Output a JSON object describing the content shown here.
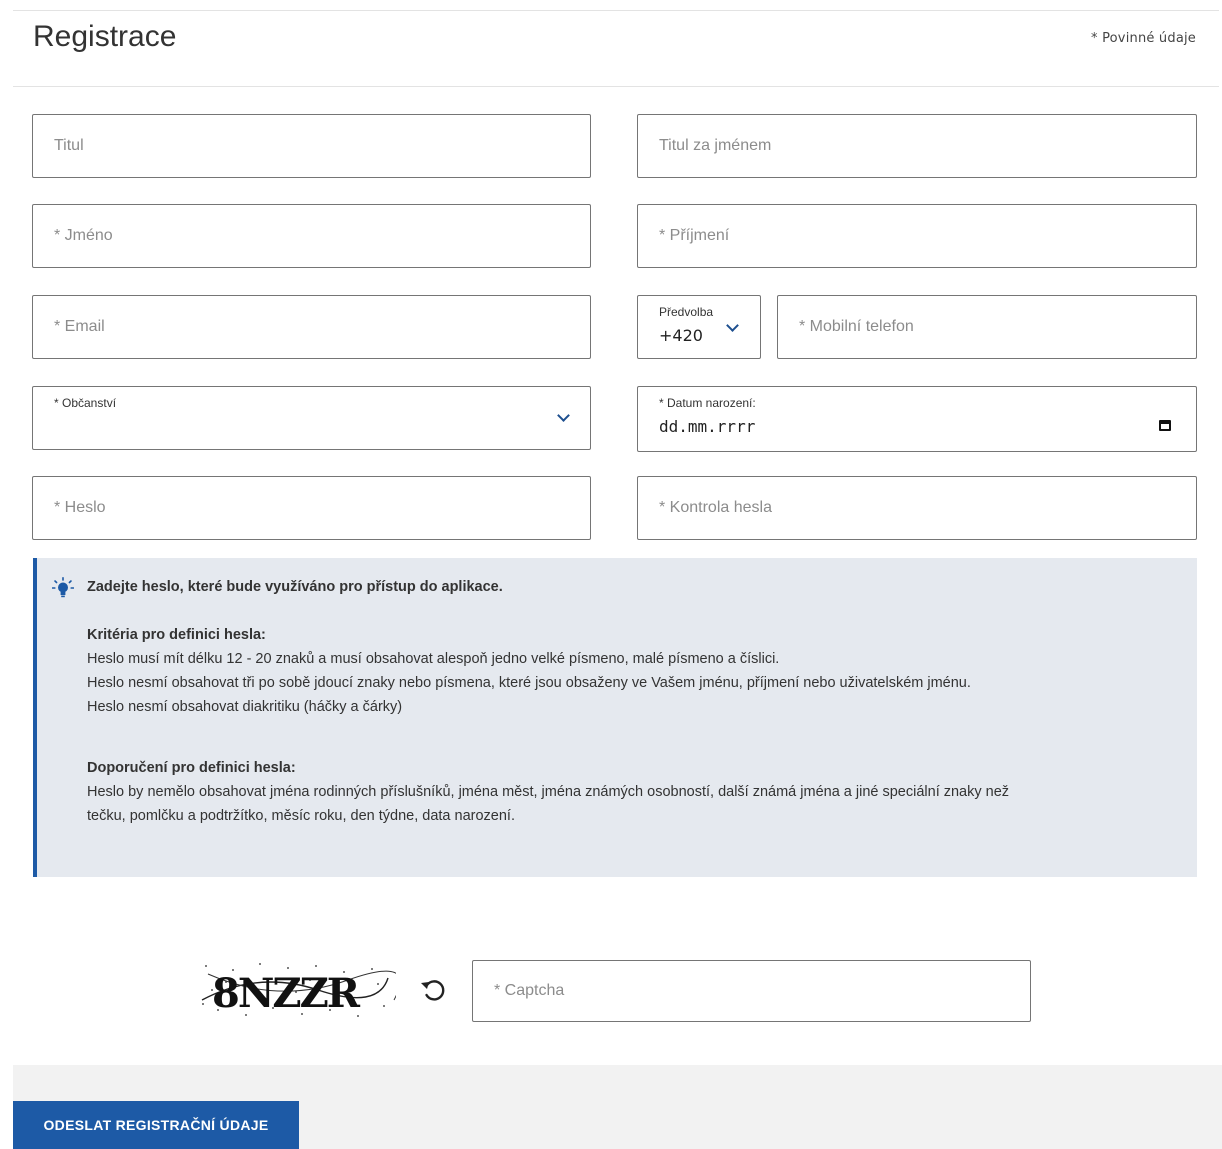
{
  "header": {
    "title": "Registrace",
    "required_note": "* Povinné údaje"
  },
  "form": {
    "title_before": {
      "placeholder": "Titul"
    },
    "title_after": {
      "placeholder": "Titul za jménem"
    },
    "first_name": {
      "placeholder": "* Jméno"
    },
    "last_name": {
      "placeholder": "* Příjmení"
    },
    "email": {
      "placeholder": "* Email"
    },
    "phone_prefix": {
      "label": "Předvolba",
      "value": "+420"
    },
    "mobile": {
      "placeholder": "* Mobilní telefon"
    },
    "citizenship": {
      "label": "* Občanství",
      "value": ""
    },
    "birth_date": {
      "label": "* Datum narození:",
      "value": "dd.mm.rrrr"
    },
    "password": {
      "placeholder": "* Heslo"
    },
    "password_check": {
      "placeholder": "* Kontrola hesla"
    }
  },
  "info": {
    "intro": "Zadejte heslo, které bude využíváno pro přístup do aplikace.",
    "criteria_heading": "Kritéria pro definici hesla:",
    "criteria_lines": [
      "Heslo musí mít délku 12 - 20 znaků a musí obsahovat alespoň jedno velké písmeno, malé písmeno a číslici.",
      "Heslo nesmí obsahovat tři po sobě jdoucí znaky nebo písmena, které jsou obsaženy ve Vašem jménu, příjmení nebo uživatelském jménu.",
      "Heslo nesmí obsahovat diakritiku (háčky a čárky)"
    ],
    "recommend_heading": "Doporučení pro definici hesla:",
    "recommend_lines": [
      "Heslo by nemělo obsahovat jména rodinných příslušníků, jména měst, jména známých osobností, další známá jména a jiné speciální znaky než",
      "tečku, pomlčku a podtržítko, měsíc roku, den týdne, data narození."
    ]
  },
  "captcha": {
    "image_text": "8NZZR",
    "placeholder": "* Captcha"
  },
  "submit": {
    "label": "ODESLAT REGISTRAČNÍ ÚDAJE"
  },
  "colors": {
    "accent": "#1d5aa6",
    "info_bg": "#e5e9ef",
    "border": "#757575"
  },
  "icons": {
    "dropdown": "chevron-down-icon",
    "calendar": "calendar-icon",
    "hint": "lightbulb-icon",
    "refresh": "refresh-icon"
  }
}
